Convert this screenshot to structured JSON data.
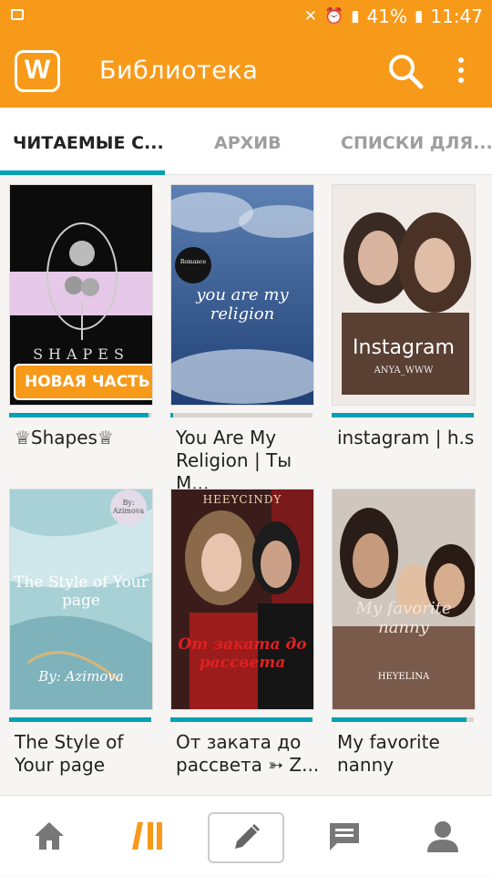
{
  "status_bar": {
    "battery_percent": "41%",
    "time": "11:47",
    "icons": [
      "image-icon",
      "mute-icon",
      "alarm-icon",
      "signal-icon",
      "battery-icon"
    ]
  },
  "app_bar": {
    "logo_letter": "W",
    "title": "Библиотека",
    "icons": [
      "search-icon",
      "more-vert-icon"
    ]
  },
  "tabs": [
    {
      "label": "ЧИТАЕМЫЕ С...",
      "active": true
    },
    {
      "label": "АРХИВ",
      "active": false
    },
    {
      "label": "СПИСКИ ДЛЯ...",
      "active": false
    }
  ],
  "stories": [
    {
      "title": "♕Shapes♕",
      "cover_text": "SHAPES",
      "badge": "НОВАЯ ЧАСТЬ",
      "progress": 0.98
    },
    {
      "title": "You Are My Religion | Ты М...",
      "cover_text": "you are my religion",
      "cover_top": "Romance",
      "progress": 0.01
    },
    {
      "title": "instagram | h.s",
      "cover_text": "Instagram",
      "cover_sub": "ANYA_WWW",
      "progress": 1.0
    },
    {
      "title": "The Style of Your page",
      "cover_text": "The Style of Your page",
      "cover_sub": "By: Azimova",
      "cover_top": "By: Azimova",
      "progress": 1.0
    },
    {
      "title": "От заката до рассвета ➳ Z...",
      "cover_text": "От заката до рассвета",
      "cover_top": "HEEYCINDY",
      "progress": 1.0
    },
    {
      "title": "My favorite nanny",
      "cover_text": "My favorite nanny",
      "cover_sub": "HEYELINA",
      "progress": 0.95
    }
  ],
  "bottom_nav": [
    "home-icon",
    "library-icon",
    "write-icon",
    "messages-icon",
    "profile-icon"
  ],
  "colors": {
    "brand": "#f79a1a",
    "accent": "#00a1b5"
  }
}
